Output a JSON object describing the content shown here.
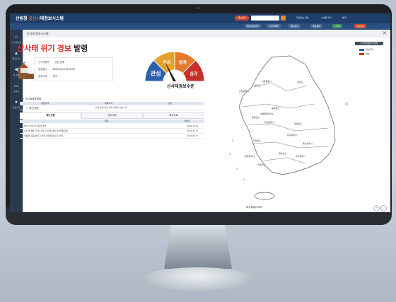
{
  "app": {
    "logo_prefix": "산림청",
    "logo_accent": "공산사",
    "logo_suffix": "태정보시스템",
    "window_title": "산사태 정보시스템",
    "header_chip": "재난안전",
    "header_links": [
      "재난정보 현황",
      "시설물 관리",
      "통계"
    ]
  },
  "nav_pills": [
    "재난유형관리",
    "산사태예방",
    "재난정보",
    "재난통계",
    "산사태",
    "재난알림"
  ],
  "sidebar": [
    {
      "icon": "home-icon",
      "label": "산사태현황"
    },
    {
      "icon": "alert-icon",
      "label": "재난관리"
    },
    {
      "icon": "megaphone-icon",
      "label": "예·경보"
    },
    {
      "icon": "monitor-icon",
      "label": "상황판"
    },
    {
      "icon": "chat-icon",
      "label": "알림마당"
    }
  ],
  "alert": {
    "title_red": "산사태 위기 경보",
    "title_black": "발령",
    "fields": [
      {
        "label": "산사태경보",
        "value": "관심 단계"
      },
      {
        "label": "발령일시",
        "value": "2023-05-15 00:00:00"
      },
      {
        "label": "발령지역",
        "value": "전국"
      }
    ]
  },
  "gauge": {
    "levels": [
      "관심",
      "주의",
      "경계",
      "심각"
    ],
    "colors": [
      "#2c5fae",
      "#e4a12b",
      "#e67a2c",
      "#c8302a"
    ],
    "caption": "산사태경보수준"
  },
  "sections": {
    "status_title": "산사태예측현황",
    "status_headers": [
      "발령단계",
      "예측지역",
      "일시"
    ],
    "status_empty": "현재 발령 중인 예측 현황이 없습니다.",
    "notice_title": "재난사항"
  },
  "tabs": [
    "재난상황",
    "공지사항",
    "보도자료"
  ],
  "list": {
    "headers": [
      "제목",
      "작성일"
    ],
    "rows": [
      {
        "title": "DMS 서버 정기점검 안내",
        "date": "2022-12-19"
      },
      {
        "title": "산사태 예방 가이드라인 산사태 대비 국민행동요령",
        "date": "2022-07-22"
      },
      {
        "title": "여름철 집중 호우기 대비 안전점검 실시 안내",
        "date": "2022-06-27"
      }
    ]
  },
  "legend": {
    "button": "산사태위험지역범례",
    "items": [
      {
        "label": "관심지역",
        "color": "#2c5fae"
      },
      {
        "label": "경보",
        "color": "#d7332b"
      }
    ]
  },
  "map": {
    "regions": [
      "경기도",
      "서울특별시",
      "인천광역시",
      "강원도",
      "충청북도",
      "충청남도",
      "세종특별자치시",
      "대전광역시",
      "경상북도",
      "대구광역시",
      "전라북도",
      "광주광역시",
      "전라남도",
      "울산광역시",
      "경상남도",
      "부산광역시",
      "제주특별자치도"
    ],
    "island_label": "제주특별자치도"
  }
}
